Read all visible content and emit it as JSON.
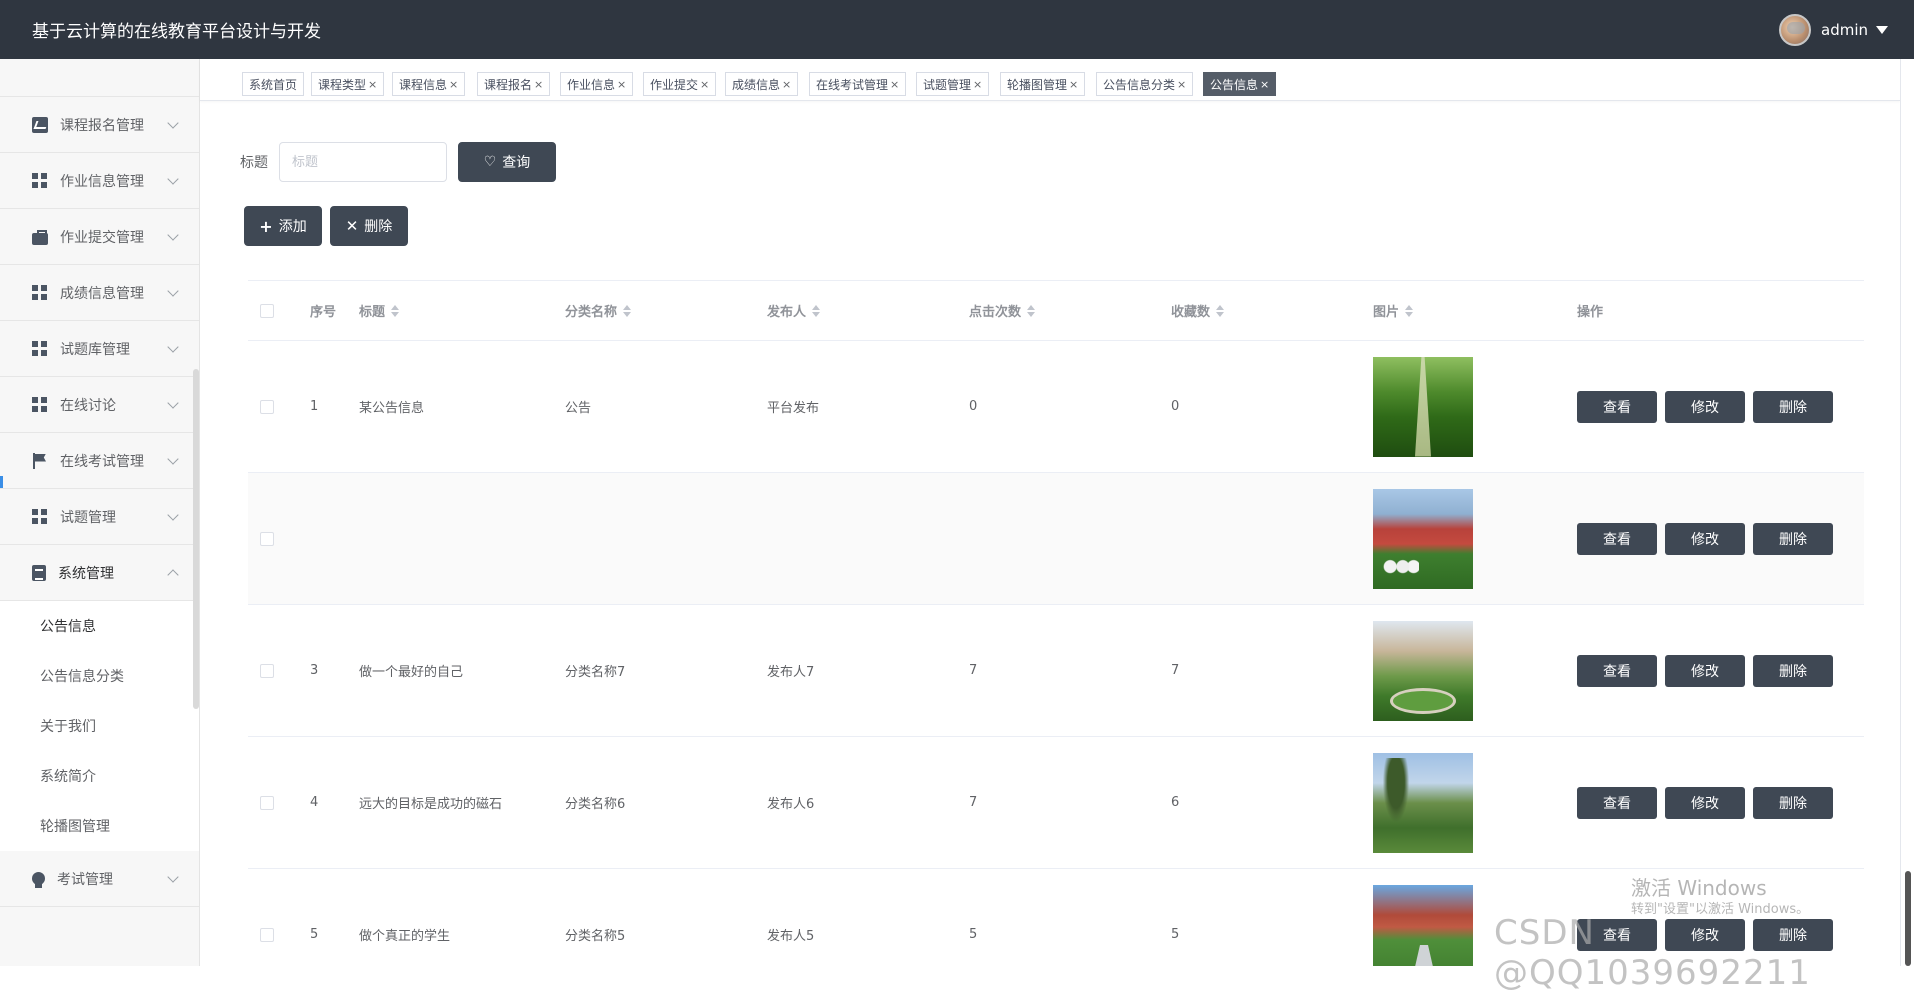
{
  "header": {
    "title": "基于云计算的在线教育平台设计与开发",
    "user": "admin"
  },
  "sidebar": {
    "items": [
      {
        "label": "课程报名管理",
        "icon": "chart-icon"
      },
      {
        "label": "作业信息管理",
        "icon": "grid-icon"
      },
      {
        "label": "作业提交管理",
        "icon": "briefcase-icon"
      },
      {
        "label": "成绩信息管理",
        "icon": "grid-icon"
      },
      {
        "label": "试题库管理",
        "icon": "grid-icon"
      },
      {
        "label": "在线讨论",
        "icon": "grid-icon"
      },
      {
        "label": "在线考试管理",
        "icon": "flag-icon"
      },
      {
        "label": "试题管理",
        "icon": "grid-icon"
      },
      {
        "label": "系统管理",
        "icon": "document-icon",
        "open": true
      }
    ],
    "submenu": [
      "公告信息",
      "公告信息分类",
      "关于我们",
      "系统简介",
      "轮播图管理"
    ],
    "last_item": {
      "label": "考试管理",
      "icon": "bulb-icon"
    }
  },
  "tabs": [
    "系统首页",
    "课程类型",
    "课程信息",
    "课程报名",
    "作业信息",
    "作业提交",
    "成绩信息",
    "在线考试管理",
    "试题管理",
    "轮播图管理",
    "公告信息分类",
    "公告信息"
  ],
  "tab_close": "×",
  "search": {
    "label": "标题",
    "placeholder": "标题",
    "value": "",
    "query_label": "查询"
  },
  "actions": {
    "add_label": "添加",
    "delete_label": "删除"
  },
  "table": {
    "headers": {
      "index": "序号",
      "title": "标题",
      "category": "分类名称",
      "publisher": "发布人",
      "clicks": "点击次数",
      "favorites": "收藏数",
      "image": "图片",
      "ops": "操作"
    },
    "rows": [
      {
        "index": "1",
        "title": "某公告信息",
        "category": "公告",
        "publisher": "平台发布",
        "clicks": "0",
        "favorites": "0"
      },
      {
        "index": "",
        "title": "",
        "category": "",
        "publisher": "",
        "clicks": "",
        "favorites": ""
      },
      {
        "index": "3",
        "title": "做一个最好的自己",
        "category": "分类名称7",
        "publisher": "发布人7",
        "clicks": "7",
        "favorites": "7"
      },
      {
        "index": "4",
        "title": "远大的目标是成功的磁石",
        "category": "分类名称6",
        "publisher": "发布人6",
        "clicks": "7",
        "favorites": "6"
      },
      {
        "index": "5",
        "title": "做个真正的学生",
        "category": "分类名称5",
        "publisher": "发布人5",
        "clicks": "5",
        "favorites": "5"
      }
    ],
    "op_labels": {
      "view": "查看",
      "edit": "修改",
      "delete": "删除"
    }
  },
  "watermark": {
    "activate_title": "激活 Windows",
    "activate_sub": "转到\"设置\"以激活 Windows。",
    "csdn": "CSDN @QQ1039692211"
  }
}
